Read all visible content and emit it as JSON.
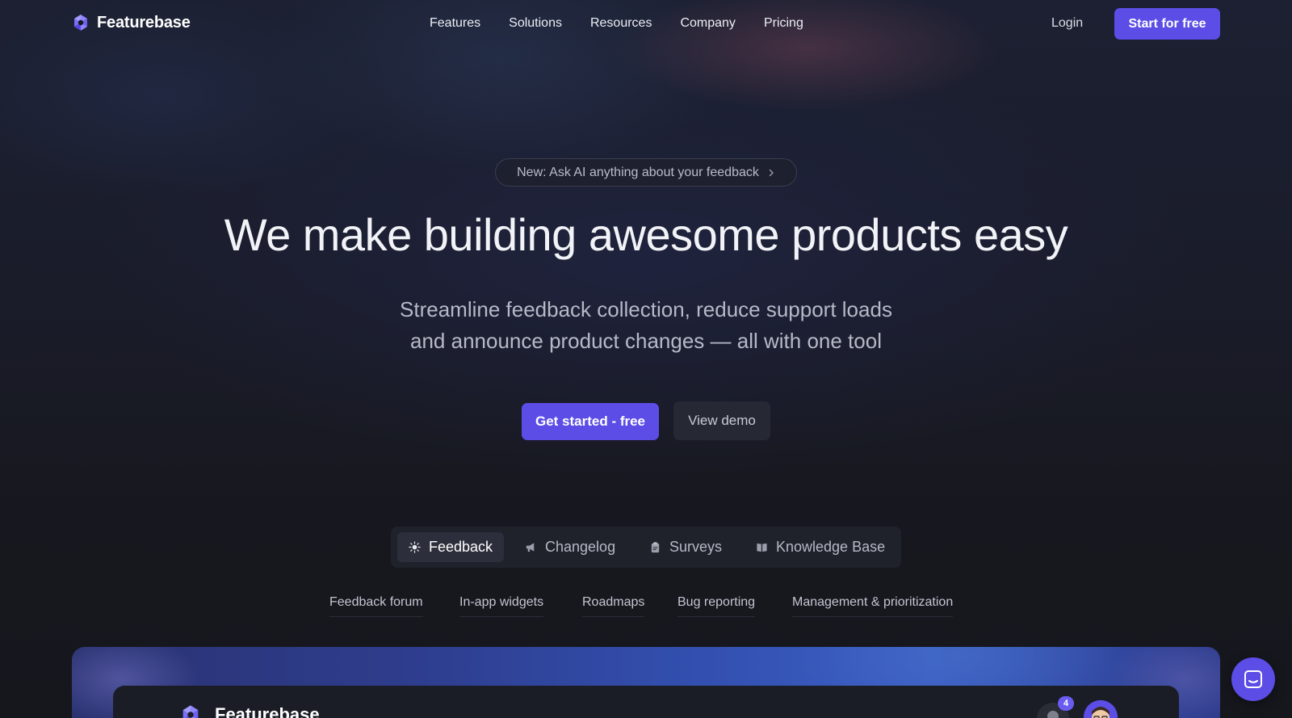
{
  "nav": {
    "brand": "Featurebase",
    "links": [
      "Features",
      "Solutions",
      "Resources",
      "Company",
      "Pricing"
    ],
    "login": "Login",
    "cta": "Start for free"
  },
  "hero": {
    "announcement": "New: Ask AI anything about your feedback",
    "headline": "We make building awesome products easy",
    "subhead_line1": "Streamline feedback collection, reduce support loads",
    "subhead_line2": "and announce product changes — all with one tool",
    "primary_cta": "Get started - free",
    "secondary_cta": "View demo"
  },
  "tabs": [
    {
      "label": "Feedback",
      "icon": "lightbulb-icon",
      "active": true
    },
    {
      "label": "Changelog",
      "icon": "megaphone-icon",
      "active": false
    },
    {
      "label": "Surveys",
      "icon": "clipboard-icon",
      "active": false
    },
    {
      "label": "Knowledge Base",
      "icon": "book-icon",
      "active": false
    }
  ],
  "subtabs": [
    "Feedback forum",
    "In-app widgets",
    "Roadmaps",
    "Bug reporting",
    "Management & prioritization"
  ],
  "preview": {
    "brand": "Featurebase",
    "notification_count": "4"
  },
  "colors": {
    "accent": "#5b4de6",
    "background": "#17181f",
    "text": "#e9eaf0"
  }
}
